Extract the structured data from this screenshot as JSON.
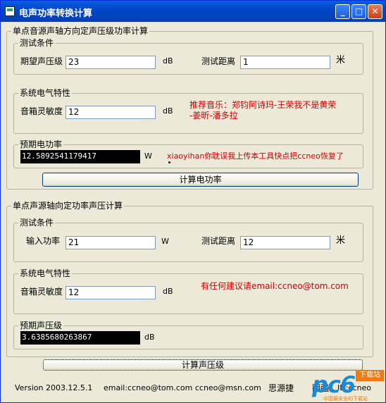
{
  "window": {
    "title": "电声功率转换计算",
    "icon": "app-icon",
    "buttons": [
      "minimize",
      "maximize",
      "close"
    ]
  },
  "section1": {
    "title": "单点音源声轴方向定声压级功率计算",
    "test": {
      "title": "测试条件",
      "spl_label": "期望声压级",
      "spl_value": "23",
      "spl_unit": "dB",
      "dist_label": "测试距离",
      "dist_value": "1",
      "dist_unit": "米"
    },
    "electric": {
      "title": "系统电气特性",
      "sens_label": "音箱灵敏度",
      "sens_value": "12",
      "sens_unit": "dB"
    },
    "music_note": [
      "推荐音乐：郑钧阿诗玛-王荣我不是黄荣",
      "-姜昕-潘多拉"
    ],
    "result": {
      "title": "预期电功率",
      "value": "12.5892541179417",
      "unit": "W"
    },
    "result_note": "xiaoyihan你耽误我上传本工具快点把ccneo恢复了",
    "calc_button": "计算电功率"
  },
  "section2": {
    "title": "单点声源轴向定功率声压计算",
    "test": {
      "title": "测试条件",
      "power_label": "输入功率",
      "power_value": "21",
      "power_unit": "W",
      "dist_label": "测试距离",
      "dist_value": "12",
      "dist_unit": "米"
    },
    "electric": {
      "title": "系统电气特性",
      "sens_label": "音箱灵敏度",
      "sens_value": "12",
      "sens_unit": "dB"
    },
    "contact_note": "有任何建议请email:ccneo@tom.com",
    "result": {
      "title": "预期声压级",
      "value": "3.6385680263867",
      "unit": "dB"
    },
    "calc_button": "计算声压级"
  },
  "footer": {
    "version": "Version 2003.12.5.1",
    "emails": "email:ccneo@tom.com ccneo@msn.com",
    "author_partial": "思源捷 ",
    "author_partial2": "翻强",
    "id_partial": "ID:ccneo"
  },
  "watermark": {
    "brand": "pc6",
    "cn": "下载站",
    "slogan": "中国最安全的下载站"
  }
}
